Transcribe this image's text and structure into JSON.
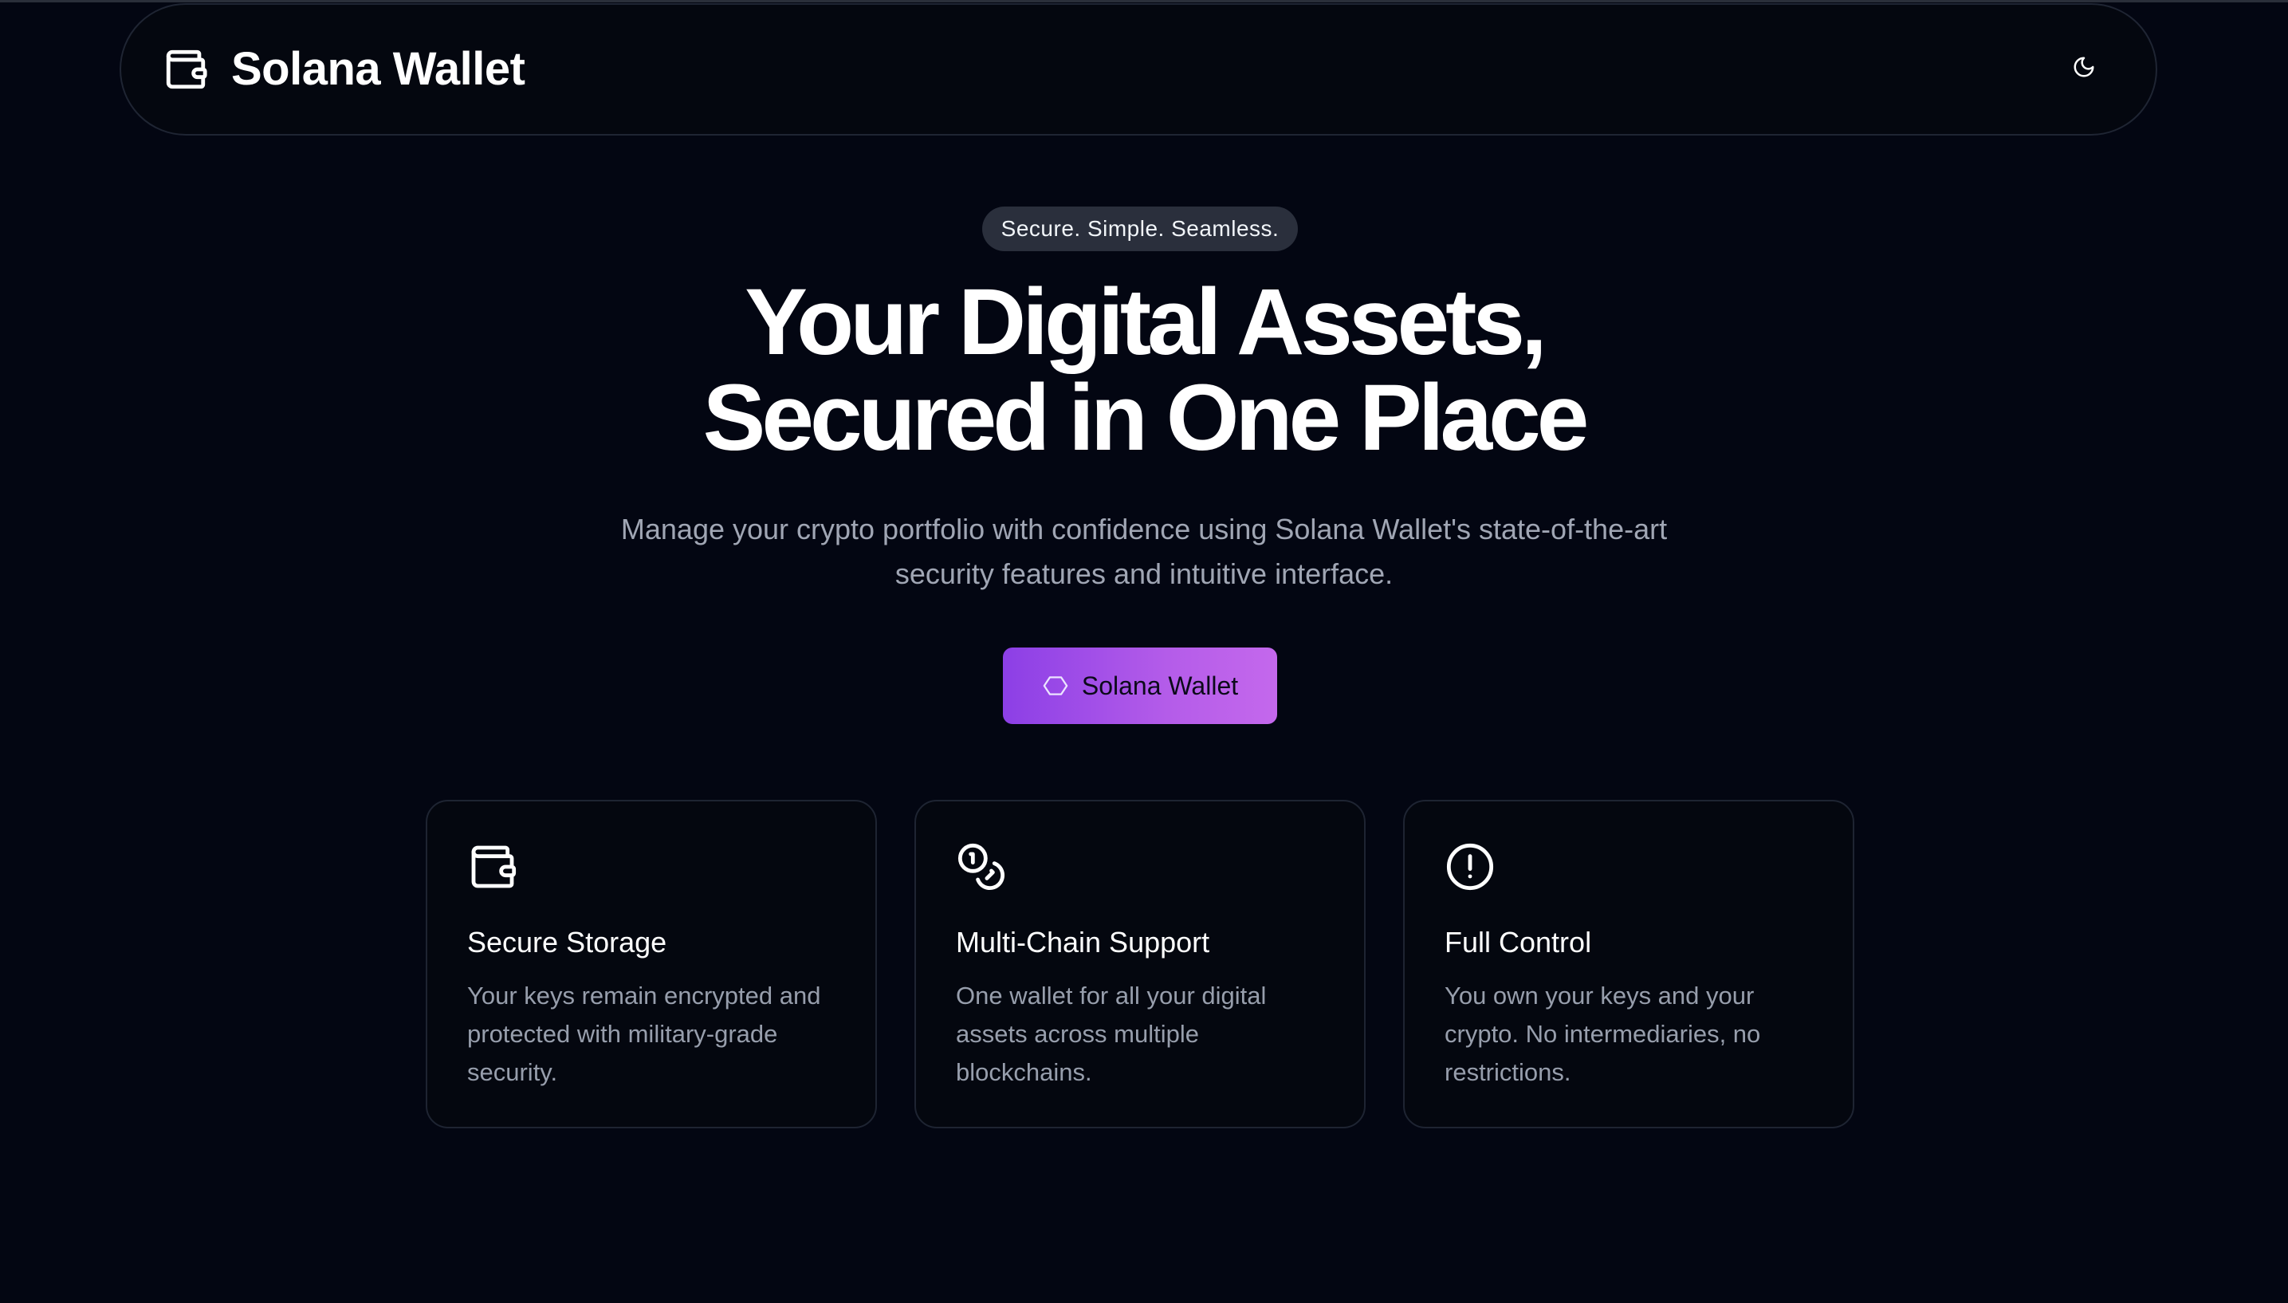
{
  "header": {
    "brand_icon": "wallet-icon",
    "brand_title": "Solana Wallet",
    "theme_toggle_icon": "moon-icon"
  },
  "hero": {
    "tagline": "Secure. Simple. Seamless.",
    "title_line1": "Your Digital Assets,",
    "title_line2": "Secured in One Place",
    "subtitle": "Manage your crypto portfolio with confidence using Solana Wallet's state-of-the-art security features and intuitive interface.",
    "cta_icon": "hexagon-icon",
    "cta_label": "Solana Wallet"
  },
  "features": [
    {
      "icon": "wallet-icon",
      "title": "Secure Storage",
      "description": "Your keys remain encrypted and protected with military-grade security."
    },
    {
      "icon": "coins-icon",
      "title": "Multi-Chain Support",
      "description": "One wallet for all your digital assets across multiple blockchains."
    },
    {
      "icon": "alert-circle-icon",
      "title": "Full Control",
      "description": "You own your keys and your crypto. No intermediaries, no restrictions."
    }
  ],
  "colors": {
    "background": "#030612",
    "accent_gradient_start": "#8c3fe6",
    "accent_gradient_end": "#c468ec",
    "muted_text": "#a0a6b4"
  }
}
